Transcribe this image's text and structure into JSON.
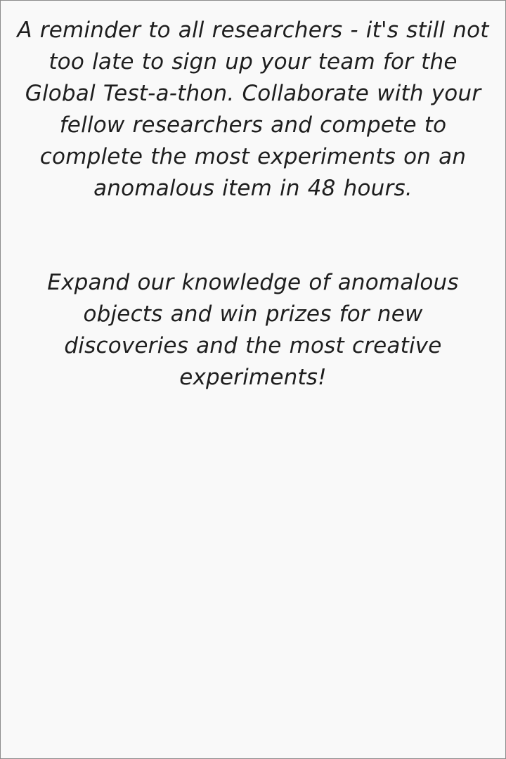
{
  "notice": {
    "paragraphs": [
      "A reminder to all researchers - it's still not too late to sign up your team for the Global Test-a-thon. Collaborate with your fellow researchers and compete to complete the most experiments on an anomalous item in 48 hours.",
      "Expand our knowledge of anomalous objects and win prizes for new discoveries and the most creative experiments!"
    ]
  },
  "colors": {
    "background": "#f9f9f9",
    "text": "#1e1e1e",
    "border": "#8c8c8c"
  }
}
